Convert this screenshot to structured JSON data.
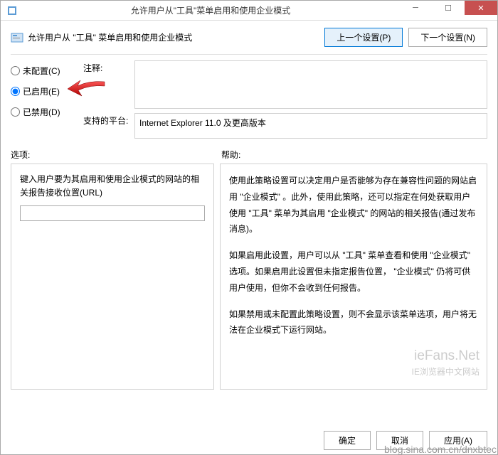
{
  "title": "允许用户从\"工具\"菜单启用和使用企业模式",
  "header_label": "允许用户从 \"工具\" 菜单启用和使用企业模式",
  "nav": {
    "prev": "上一个设置(P)",
    "next": "下一个设置(N)"
  },
  "radios": {
    "not_configured": "未配置(C)",
    "enabled": "已启用(E)",
    "disabled": "已禁用(D)",
    "selected": "enabled"
  },
  "labels": {
    "comment": "注释:",
    "platform": "支持的平台:",
    "options": "选项:",
    "help": "帮助:"
  },
  "comment_value": "",
  "platform_value": "Internet Explorer 11.0 及更高版本",
  "option": {
    "desc": "键入用户要为其启用和使用企业模式的网站的相关报告接收位置(URL)",
    "url_value": ""
  },
  "help": {
    "p1": "使用此策略设置可以决定用户是否能够为存在兼容性问题的网站启用 \"企业模式\" 。此外，使用此策略，还可以指定在何处获取用户使用 \"工具\" 菜单为其启用 \"企业模式\" 的网站的相关报告(通过发布消息)。",
    "p2": "如果启用此设置，用户可以从 \"工具\" 菜单查看和使用 \"企业模式\" 选项。如果启用此设置但未指定报告位置， \"企业模式\" 仍将可供用户使用，但你不会收到任何报告。",
    "p3": "如果禁用或未配置此策略设置，则不会显示该菜单选项，用户将无法在企业模式下运行网站。"
  },
  "footer": {
    "ok": "确定",
    "cancel": "取消",
    "apply": "应用(A)"
  },
  "watermark": {
    "line1": "ieFans.Net",
    "line2": "IE浏览器中文网站",
    "blog": "blog.sina.com.cn/dnxbtec"
  }
}
